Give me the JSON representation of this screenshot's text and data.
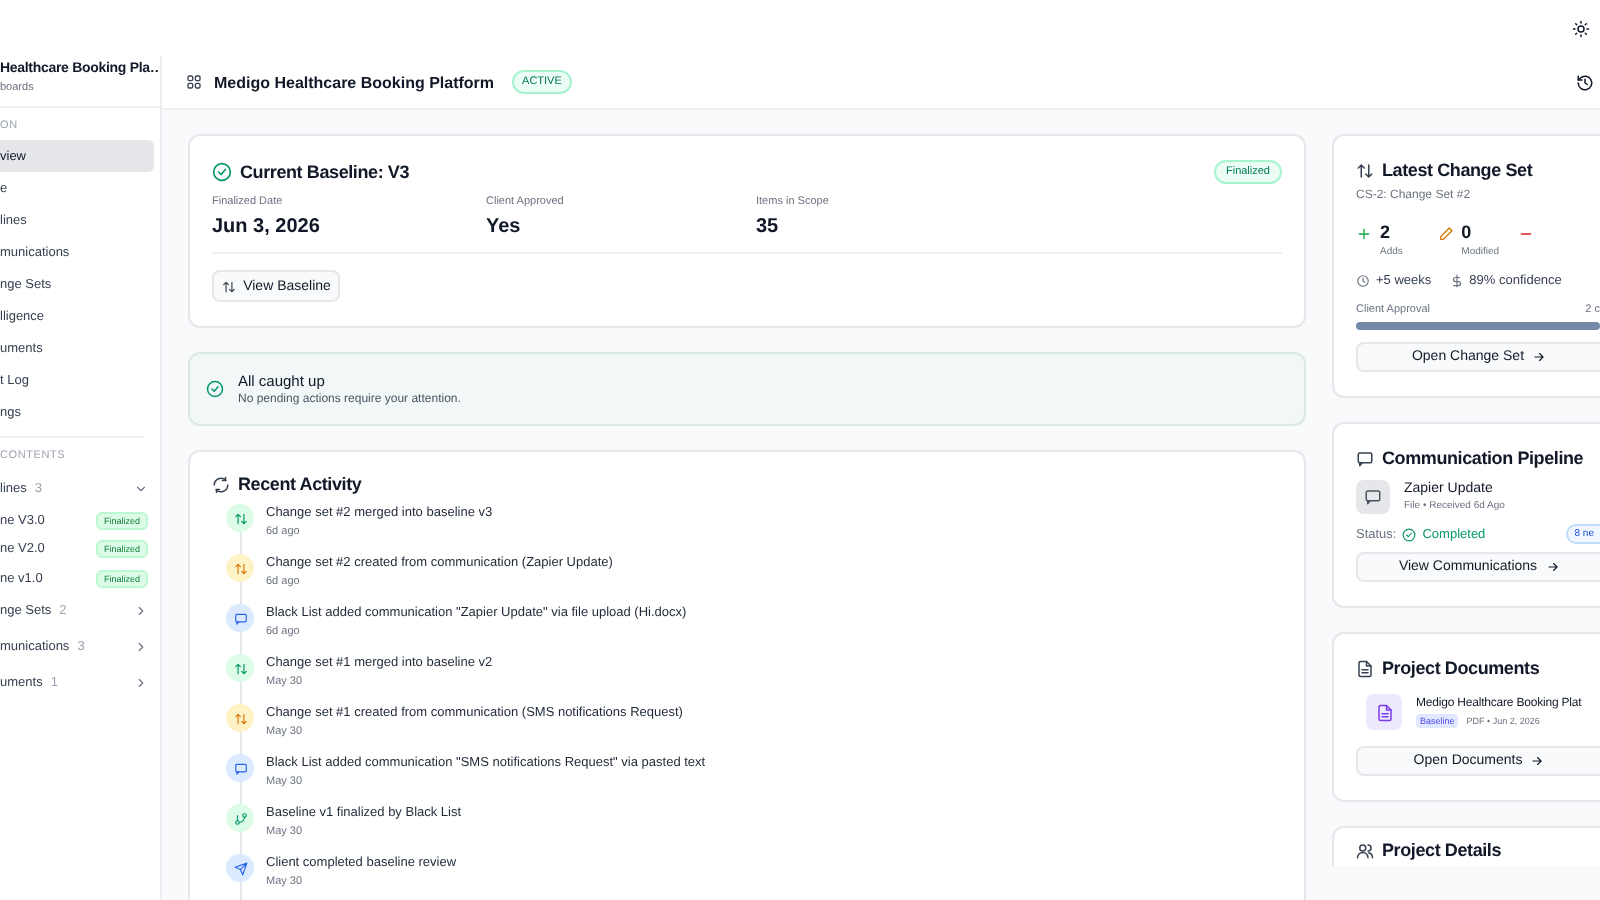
{
  "sidebar": {
    "project_title": "Healthcare Booking Pla…",
    "subtitle": "boards",
    "section_label": "ON",
    "nav": [
      {
        "label": "view",
        "selected": true
      },
      {
        "label": "e",
        "selected": false
      },
      {
        "label": "lines",
        "selected": false
      },
      {
        "label": "munications",
        "selected": false
      },
      {
        "label": "nge Sets",
        "selected": false
      },
      {
        "label": "lligence",
        "selected": false
      },
      {
        "label": "uments",
        "selected": false
      },
      {
        "label": "t Log",
        "selected": false
      },
      {
        "label": "ngs",
        "selected": false
      }
    ],
    "contents_label": "CONTENTS",
    "groups": [
      {
        "label": "lines",
        "count": "3",
        "expanded": true,
        "children": [
          {
            "label": "ne V3.0",
            "badge": "Finalized"
          },
          {
            "label": "ne V2.0",
            "badge": "Finalized"
          },
          {
            "label": "ne v1.0",
            "badge": "Finalized"
          }
        ]
      },
      {
        "label": "nge Sets",
        "count": "2",
        "expanded": false
      },
      {
        "label": "munications",
        "count": "3",
        "expanded": false
      },
      {
        "label": "uments",
        "count": "1",
        "expanded": false
      }
    ]
  },
  "header": {
    "title": "Medigo Healthcare Booking Platform",
    "status": "ACTIVE"
  },
  "baseline": {
    "title": "Current Baseline: V3",
    "badge": "Finalized",
    "fields": [
      {
        "label": "Finalized Date",
        "value": "Jun 3, 2026"
      },
      {
        "label": "Client Approved",
        "value": "Yes"
      },
      {
        "label": "Items in Scope",
        "value": "35"
      }
    ],
    "button": "View Baseline"
  },
  "notice": {
    "title": "All caught up",
    "message": "No pending actions require your attention."
  },
  "activity": {
    "title": "Recent Activity",
    "items": [
      {
        "kind": "merge",
        "text": "Change set #2 merged into baseline v3",
        "time": "6d ago"
      },
      {
        "kind": "change",
        "text": "Change set #2 created from communication (Zapier Update)",
        "time": "6d ago"
      },
      {
        "kind": "message",
        "text": "Black List added communication \"Zapier Update\" via file upload (Hi.docx)",
        "time": "6d ago"
      },
      {
        "kind": "merge",
        "text": "Change set #1 merged into baseline v2",
        "time": "May 30"
      },
      {
        "kind": "change",
        "text": "Change set #1 created from communication (SMS notifications Request)",
        "time": "May 30"
      },
      {
        "kind": "message",
        "text": "Black List added communication \"SMS notifications Request\" via pasted text",
        "time": "May 30"
      },
      {
        "kind": "finalize",
        "text": "Baseline v1 finalized by Black List",
        "time": "May 30"
      },
      {
        "kind": "review",
        "text": "Client completed baseline review",
        "time": "May 30"
      }
    ]
  },
  "change_set": {
    "title": "Latest Change Set",
    "subtitle": "CS-2: Change Set #2",
    "stats": [
      {
        "kind": "add",
        "value": "2",
        "label": "Adds"
      },
      {
        "kind": "modify",
        "value": "0",
        "label": "Modified"
      },
      {
        "kind": "remove"
      }
    ],
    "duration": "+5 weeks",
    "confidence": "89% confidence",
    "approval_label": "Client Approval",
    "approval_reading": "2 c",
    "level": 1,
    "button": "Open Change Set"
  },
  "communication": {
    "title": "Communication Pipeline",
    "item_title": "Zapier Update",
    "item_meta": "File • Received 6d Ago",
    "status_label": "Status:",
    "status": "Completed",
    "badge": "8 ne",
    "button": "View Communications"
  },
  "documents": {
    "title": "Project Documents",
    "doc_name": "Medigo Healthcare Booking Plat",
    "doc_tag": "Baseline",
    "doc_meta": "PDF • Jun 2, 2026",
    "button": "Open Documents"
  },
  "details": {
    "title": "Project Details"
  }
}
